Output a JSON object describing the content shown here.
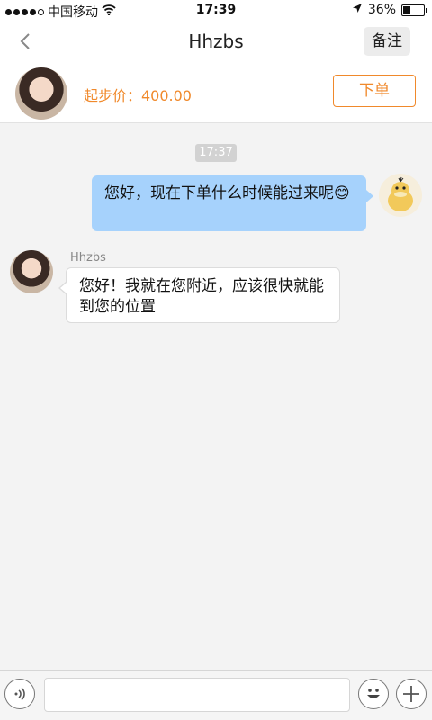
{
  "status_bar": {
    "carrier": "中国移动",
    "time": "17:39",
    "battery": "36%",
    "battery_level": 0.36
  },
  "nav": {
    "title": "Hhzbs",
    "note_label": "备注"
  },
  "order_bar": {
    "price_label": "起步价：400.00",
    "order_label": "下单"
  },
  "chat": {
    "timestamp": "17:37",
    "outgoing": {
      "text": "您好，现在下单什么时候能过来呢😊"
    },
    "incoming": {
      "sender": "Hhzbs",
      "text": "您好！我就在您附近，应该很快就能到您的位置"
    }
  },
  "input_bar": {
    "placeholder": ""
  },
  "colors": {
    "accent": "#f0892b",
    "outgoing_bubble": "#a6d2fc",
    "background": "#f3f3f3"
  }
}
